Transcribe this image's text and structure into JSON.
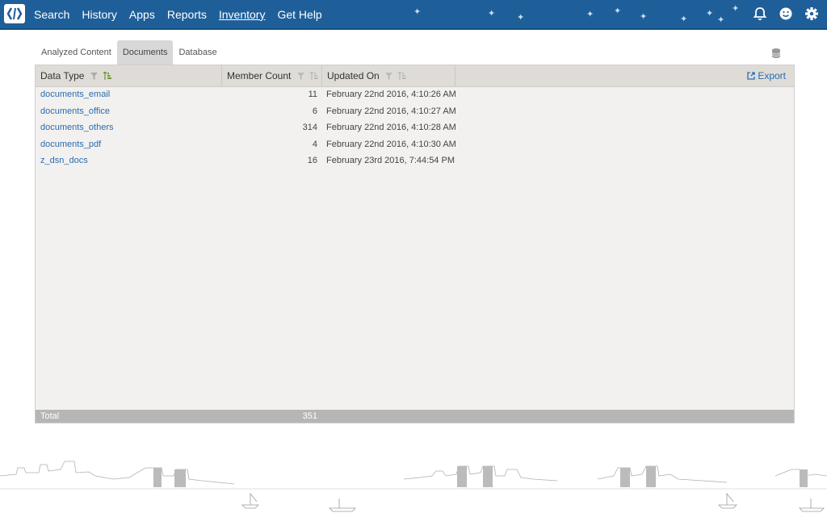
{
  "nav": {
    "items": [
      "Search",
      "History",
      "Apps",
      "Reports",
      "Inventory",
      "Get Help"
    ],
    "active": "Inventory"
  },
  "top_icons": [
    "bell-icon",
    "smiley-icon",
    "gear-icon"
  ],
  "tabs": [
    "Analyzed Content",
    "Documents",
    "Database"
  ],
  "selected_tab": "Documents",
  "grid": {
    "columns": [
      "Data Type",
      "Member Count",
      "Updated On"
    ],
    "export_label": "Export",
    "rows": [
      {
        "type": "documents_email",
        "count": "11",
        "updated": "February 22nd 2016, 4:10:26 AM"
      },
      {
        "type": "documents_office",
        "count": "6",
        "updated": "February 22nd 2016, 4:10:27 AM"
      },
      {
        "type": "documents_others",
        "count": "314",
        "updated": "February 22nd 2016, 4:10:28 AM"
      },
      {
        "type": "documents_pdf",
        "count": "4",
        "updated": "February 22nd 2016, 4:10:30 AM"
      },
      {
        "type": "z_dsn_docs",
        "count": "16",
        "updated": "February 23rd 2016, 7:44:54 PM"
      }
    ],
    "footer_label": "Total",
    "footer_total": "351"
  },
  "colors": {
    "topbar": "#1f5f99",
    "link": "#2a6cb0",
    "header_bg": "#dfdcd8",
    "footer_bg": "#b6b6b4"
  }
}
